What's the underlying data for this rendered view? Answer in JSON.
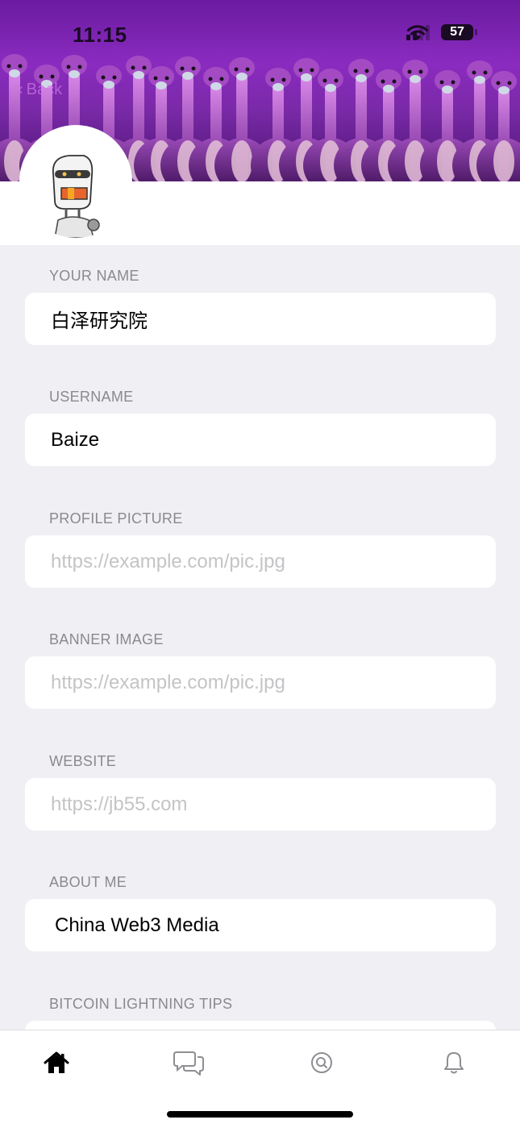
{
  "status_bar": {
    "time": "11:15",
    "battery": "57"
  },
  "nav": {
    "back_label": "Back"
  },
  "form": {
    "fields": [
      {
        "label": "YOUR NAME",
        "value": "白泽研究院",
        "placeholder": ""
      },
      {
        "label": "USERNAME",
        "value": "Baize",
        "placeholder": ""
      },
      {
        "label": "PROFILE PICTURE",
        "value": "",
        "placeholder": "https://example.com/pic.jpg"
      },
      {
        "label": "BANNER IMAGE",
        "value": "",
        "placeholder": "https://example.com/pic.jpg"
      },
      {
        "label": "WEBSITE",
        "value": "",
        "placeholder": "https://jb55.com"
      },
      {
        "label": "ABOUT ME",
        "value": "China Web3 Media",
        "placeholder": ""
      },
      {
        "label": "BITCOIN LIGHTNING TIPS",
        "value": "",
        "placeholder": ""
      }
    ]
  },
  "tabbar": {
    "items": [
      {
        "icon": "home-icon",
        "active": true
      },
      {
        "icon": "chat-bubbles-icon",
        "active": false
      },
      {
        "icon": "search-icon",
        "active": false
      },
      {
        "icon": "bell-icon",
        "active": false
      }
    ]
  },
  "colors": {
    "banner": "#7a2aa8",
    "background": "#f0eff4",
    "label": "#8a8a8e",
    "placeholder": "#c4c4c7"
  }
}
